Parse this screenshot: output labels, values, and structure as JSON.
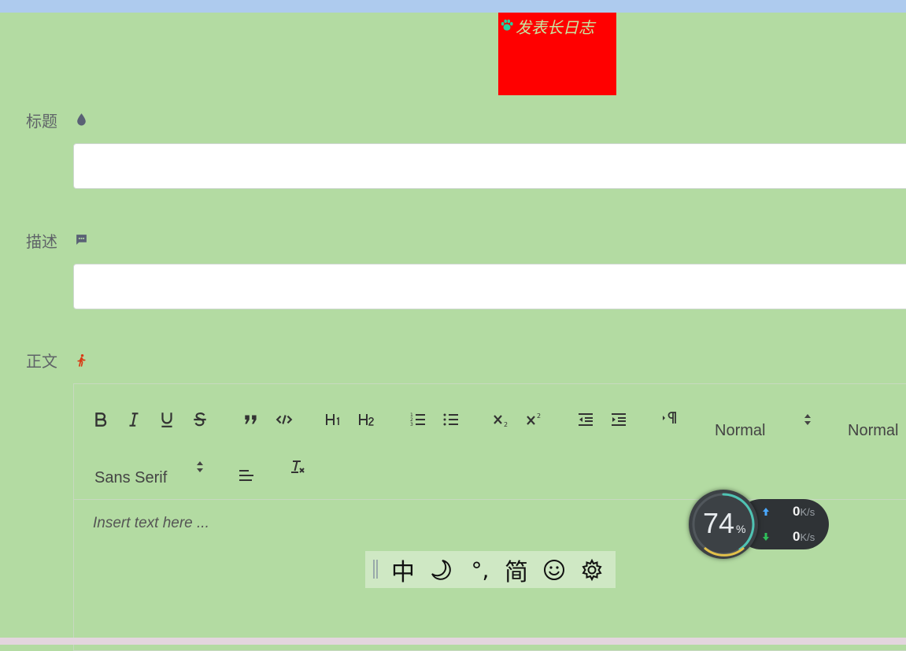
{
  "header": {
    "title": "发表长日志"
  },
  "form": {
    "title_label": "标题",
    "title_value": "",
    "description_label": "描述",
    "description_value": "",
    "body_label": "正文"
  },
  "editor": {
    "header_select": "Normal",
    "size_select": "Normal",
    "font_select": "Sans Serif",
    "placeholder": "Insert text here ...",
    "buttons": [
      "bold",
      "italic",
      "underline",
      "strike",
      "blockquote",
      "code-block",
      "h1",
      "h2",
      "ordered-list",
      "bullet-list",
      "subscript",
      "superscript",
      "outdent",
      "indent",
      "rtl",
      "align",
      "clean"
    ]
  },
  "ime": {
    "mode": "中",
    "punct": "°,",
    "charset": "简"
  },
  "net_monitor": {
    "percent": "74",
    "percent_sign": "%",
    "upload": "0",
    "download": "0",
    "unit": "K/s",
    "percent_value": 74
  },
  "colors": {
    "background": "#b3dba2",
    "header_bg": "#ff0000",
    "header_text": "#c9e6a0"
  }
}
